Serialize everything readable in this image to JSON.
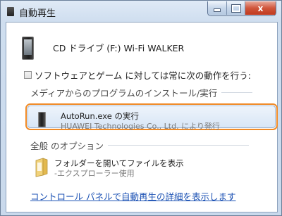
{
  "window": {
    "title": "自動再生",
    "controls": {
      "minimize": "minimize-icon",
      "maximize": "maximize-icon",
      "close": "close-icon",
      "close_glyph": "x"
    }
  },
  "device": {
    "label": "CD ドライブ (F:) Wi-Fi WALKER",
    "icon": "device-icon"
  },
  "always_do": {
    "label": "ソフトウェアとゲーム に対しては常に次の動作を行う:",
    "checked": false
  },
  "sections": {
    "media_install": "メディアからのプログラムのインストール/実行",
    "general_options": "全般 のオプション"
  },
  "actions": {
    "run_autorun": {
      "title": "AutoRun.exe の実行",
      "subtitle": "HUAWEI Technologies Co., Ltd. により発行",
      "icon": "device-icon"
    },
    "open_folder": {
      "title": "フォルダーを開いてファイルを表示",
      "subtitle": "-エクスプローラー使用",
      "icon": "folder-icon"
    }
  },
  "footer": {
    "link": "コントロール パネルで自動再生の詳細を表示します"
  },
  "colors": {
    "highlight_border": "#f08a26",
    "link": "#1c52b4",
    "close_button": "#c9472b"
  }
}
